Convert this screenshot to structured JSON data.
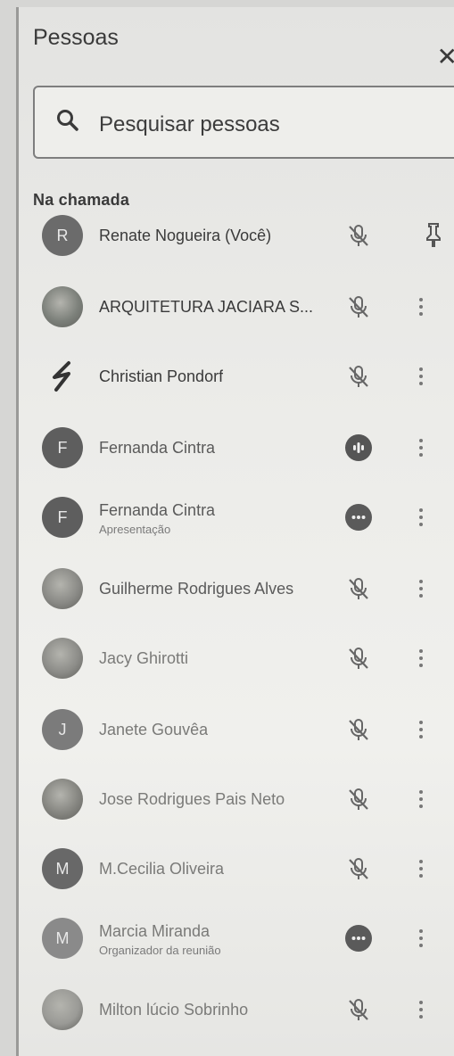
{
  "panel": {
    "title": "Pessoas",
    "close_icon": "close-icon"
  },
  "search": {
    "placeholder": "Pesquisar pessoas",
    "icon": "search-icon"
  },
  "section_label": "Na chamada",
  "participants": [
    {
      "name": "Renate Nogueira (Você)",
      "subtitle": "",
      "avatar_letter": "R",
      "avatar_color": "#6b6b6b",
      "status": "mic-off",
      "action": "pin"
    },
    {
      "name": "ARQUITETURA JACIARA S...",
      "subtitle": "",
      "avatar_letter": "",
      "avatar_color": "#7c807a",
      "status": "mic-off",
      "action": "more"
    },
    {
      "name": "Christian Pondorf",
      "subtitle": "",
      "avatar_letter": "",
      "avatar_color": "transparent",
      "status": "mic-off",
      "action": "more"
    },
    {
      "name": "Fernanda Cintra",
      "subtitle": "",
      "avatar_letter": "F",
      "avatar_color": "#5e5e5e",
      "status": "speaking",
      "action": "more"
    },
    {
      "name": "Fernanda Cintra",
      "subtitle": "Apresentação",
      "avatar_letter": "F",
      "avatar_color": "#5e5e5e",
      "status": "presenting",
      "action": "more"
    },
    {
      "name": "Guilherme Rodrigues Alves",
      "subtitle": "",
      "avatar_letter": "",
      "avatar_color": "#8a8a86",
      "status": "mic-off",
      "action": "more"
    },
    {
      "name": "Jacy Ghirotti",
      "subtitle": "",
      "avatar_letter": "",
      "avatar_color": "#8c8c88",
      "status": "mic-off",
      "action": "more"
    },
    {
      "name": "Janete Gouvêa",
      "subtitle": "",
      "avatar_letter": "J",
      "avatar_color": "#7b7b7b",
      "status": "mic-off",
      "action": "more"
    },
    {
      "name": "Jose Rodrigues Pais Neto",
      "subtitle": "",
      "avatar_letter": "",
      "avatar_color": "#858580",
      "status": "mic-off",
      "action": "more"
    },
    {
      "name": "M.Cecilia Oliveira",
      "subtitle": "",
      "avatar_letter": "M",
      "avatar_color": "#686868",
      "status": "mic-off",
      "action": "more"
    },
    {
      "name": "Marcia Miranda",
      "subtitle": "Organizador da reunião",
      "avatar_letter": "M",
      "avatar_color": "#8a8a8a",
      "status": "presenting",
      "action": "more"
    },
    {
      "name": "Milton lúcio Sobrinho",
      "subtitle": "",
      "avatar_letter": "",
      "avatar_color": "#9a9a96",
      "status": "mic-off",
      "action": "more"
    }
  ]
}
